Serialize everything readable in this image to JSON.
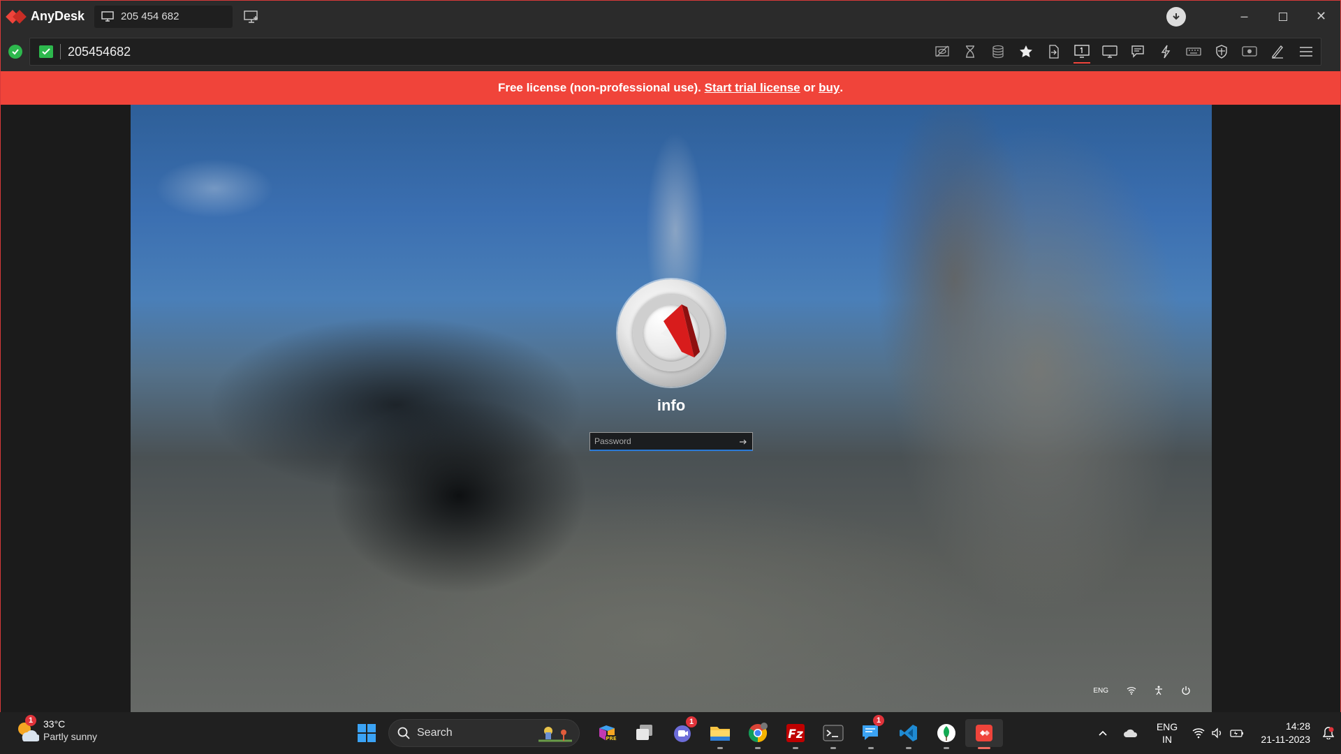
{
  "app": {
    "name": "AnyDesk"
  },
  "tab": {
    "label": "205 454 682"
  },
  "address": {
    "value": "205454682"
  },
  "banner": {
    "prefix": "Free license (non-professional use). ",
    "trial_link": "Start trial license",
    "middle": " or ",
    "buy_link": "buy",
    "suffix": "."
  },
  "remote": {
    "username": "info",
    "password_placeholder": "Password",
    "tray_lang": "ENG"
  },
  "taskbar": {
    "weather": {
      "temp": "33°C",
      "desc": "Partly sunny",
      "badge": "1"
    },
    "search_placeholder": "Search",
    "teams_badge": "1",
    "messages_badge": "1",
    "lang_top": "ENG",
    "lang_bottom": "IN",
    "time": "14:28",
    "date": "21-11-2023"
  },
  "colors": {
    "accent": "#ef443b",
    "ok": "#2db84d",
    "banner": "#f0443a",
    "focus": "#2a7ad8"
  }
}
